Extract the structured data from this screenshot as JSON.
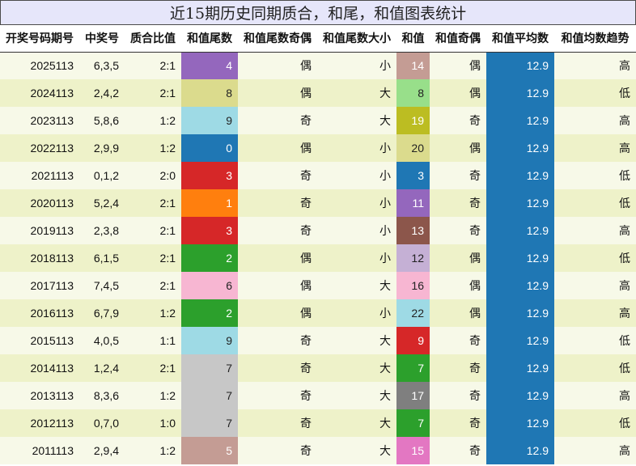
{
  "title": "近15期历史同期质合，和尾，和值图表统计",
  "headers": [
    "开奖号码期号",
    "中奖号",
    "质合比值",
    "和值尾数",
    "和值尾数奇偶",
    "和值尾数大小",
    "和值",
    "和值奇偶",
    "和值平均数",
    "和值均数趋势"
  ],
  "colors": {
    "purple": "#9467bd",
    "olive_light": "#dbdb8d",
    "cyan_light": "#9edae5",
    "blue": "#1f77b4",
    "red": "#d62728",
    "orange": "#ff7f0e",
    "green": "#2ca02c",
    "pink_light": "#f7b6d2",
    "gray_light": "#c7c7c7",
    "rose_brown": "#c49c94",
    "green_light": "#98df8a",
    "olive": "#bcbd22",
    "lavender": "#c5b0d5",
    "brown": "#8c564b",
    "gray": "#7f7f7f",
    "pink": "#e377c2"
  },
  "rows": [
    {
      "period": "2025113",
      "numbers": "6,3,5",
      "ratio": "2:1",
      "tail": "4",
      "tail_color": "#9467bd",
      "tail_parity": "偶",
      "tail_size": "小",
      "sum": "14",
      "sum_color": "#c49c94",
      "sum_parity": "偶",
      "avg": "12.9",
      "trend": "高"
    },
    {
      "period": "2024113",
      "numbers": "2,4,2",
      "ratio": "2:1",
      "tail": "8",
      "tail_color": "#dbdb8d",
      "tail_parity": "偶",
      "tail_size": "大",
      "sum": "8",
      "sum_color": "#98df8a",
      "sum_parity": "偶",
      "avg": "12.9",
      "trend": "低"
    },
    {
      "period": "2023113",
      "numbers": "5,8,6",
      "ratio": "1:2",
      "tail": "9",
      "tail_color": "#9edae5",
      "tail_parity": "奇",
      "tail_size": "大",
      "sum": "19",
      "sum_color": "#bcbd22",
      "sum_parity": "奇",
      "avg": "12.9",
      "trend": "高"
    },
    {
      "period": "2022113",
      "numbers": "2,9,9",
      "ratio": "1:2",
      "tail": "0",
      "tail_color": "#1f77b4",
      "tail_parity": "偶",
      "tail_size": "小",
      "sum": "20",
      "sum_color": "#dbdb8d",
      "sum_parity": "偶",
      "avg": "12.9",
      "trend": "高"
    },
    {
      "period": "2021113",
      "numbers": "0,1,2",
      "ratio": "2:0",
      "tail": "3",
      "tail_color": "#d62728",
      "tail_parity": "奇",
      "tail_size": "小",
      "sum": "3",
      "sum_color": "#1f77b4",
      "sum_parity": "奇",
      "avg": "12.9",
      "trend": "低"
    },
    {
      "period": "2020113",
      "numbers": "5,2,4",
      "ratio": "2:1",
      "tail": "1",
      "tail_color": "#ff7f0e",
      "tail_parity": "奇",
      "tail_size": "小",
      "sum": "11",
      "sum_color": "#9467bd",
      "sum_parity": "奇",
      "avg": "12.9",
      "trend": "低"
    },
    {
      "period": "2019113",
      "numbers": "2,3,8",
      "ratio": "2:1",
      "tail": "3",
      "tail_color": "#d62728",
      "tail_parity": "奇",
      "tail_size": "小",
      "sum": "13",
      "sum_color": "#8c564b",
      "sum_parity": "奇",
      "avg": "12.9",
      "trend": "高"
    },
    {
      "period": "2018113",
      "numbers": "6,1,5",
      "ratio": "2:1",
      "tail": "2",
      "tail_color": "#2ca02c",
      "tail_parity": "偶",
      "tail_size": "小",
      "sum": "12",
      "sum_color": "#c5b0d5",
      "sum_parity": "偶",
      "avg": "12.9",
      "trend": "低"
    },
    {
      "period": "2017113",
      "numbers": "7,4,5",
      "ratio": "2:1",
      "tail": "6",
      "tail_color": "#f7b6d2",
      "tail_parity": "偶",
      "tail_size": "大",
      "sum": "16",
      "sum_color": "#f7b6d2",
      "sum_parity": "偶",
      "avg": "12.9",
      "trend": "高"
    },
    {
      "period": "2016113",
      "numbers": "6,7,9",
      "ratio": "1:2",
      "tail": "2",
      "tail_color": "#2ca02c",
      "tail_parity": "偶",
      "tail_size": "小",
      "sum": "22",
      "sum_color": "#9edae5",
      "sum_parity": "偶",
      "avg": "12.9",
      "trend": "高"
    },
    {
      "period": "2015113",
      "numbers": "4,0,5",
      "ratio": "1:1",
      "tail": "9",
      "tail_color": "#9edae5",
      "tail_parity": "奇",
      "tail_size": "大",
      "sum": "9",
      "sum_color": "#d62728",
      "sum_parity": "奇",
      "avg": "12.9",
      "trend": "低"
    },
    {
      "period": "2014113",
      "numbers": "1,2,4",
      "ratio": "2:1",
      "tail": "7",
      "tail_color": "#c7c7c7",
      "tail_parity": "奇",
      "tail_size": "大",
      "sum": "7",
      "sum_color": "#2ca02c",
      "sum_parity": "奇",
      "avg": "12.9",
      "trend": "低"
    },
    {
      "period": "2013113",
      "numbers": "8,3,6",
      "ratio": "1:2",
      "tail": "7",
      "tail_color": "#c7c7c7",
      "tail_parity": "奇",
      "tail_size": "大",
      "sum": "17",
      "sum_color": "#7f7f7f",
      "sum_parity": "奇",
      "avg": "12.9",
      "trend": "高"
    },
    {
      "period": "2012113",
      "numbers": "0,7,0",
      "ratio": "1:0",
      "tail": "7",
      "tail_color": "#c7c7c7",
      "tail_parity": "奇",
      "tail_size": "大",
      "sum": "7",
      "sum_color": "#2ca02c",
      "sum_parity": "奇",
      "avg": "12.9",
      "trend": "低"
    },
    {
      "period": "2011113",
      "numbers": "2,9,4",
      "ratio": "1:2",
      "tail": "5",
      "tail_color": "#c49c94",
      "tail_parity": "奇",
      "tail_size": "大",
      "sum": "15",
      "sum_color": "#e377c2",
      "sum_parity": "奇",
      "avg": "12.9",
      "trend": "高"
    }
  ]
}
